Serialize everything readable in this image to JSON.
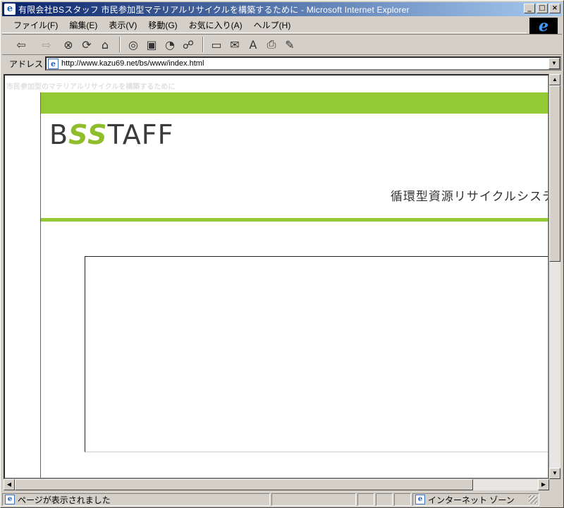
{
  "window": {
    "title": "有限会社BSスタッフ 市民参加型マテリアルリサイクルを構築するために - Microsoft Internet Explorer",
    "controls": {
      "minimize": "_",
      "maximize": "□",
      "close": "×"
    }
  },
  "menubar": {
    "items": [
      "ファイル(F)",
      "編集(E)",
      "表示(V)",
      "移動(G)",
      "お気に入り(A)",
      "ヘルプ(H)"
    ]
  },
  "toolbar": {
    "back": "⇦",
    "forward": "⇨",
    "stop": "⊗",
    "refresh": "⟳",
    "home": "⌂",
    "search": "◎",
    "favorites": "▣",
    "history": "◔",
    "channels": "☍",
    "fullscreen": "▭",
    "mail": "✉",
    "fonts": "A",
    "print": "⎙",
    "edit": "✎"
  },
  "address": {
    "label": "アドレス",
    "url": "http://www.kazu69.net/bs/www/index.html"
  },
  "page": {
    "caption": "市民参加型のマテリアルリサイクルを構築するために",
    "logo_b": "B",
    "logo_ss": "SS",
    "logo_rest": "TAFF",
    "subtitle": "循環型資源リサイクルシステ",
    "bottom_left_text": "",
    "bottom_right_text": ""
  },
  "colors": {
    "accent_green": "#93c935",
    "title_blue": "#0a246a"
  },
  "status": {
    "message": "ページが表示されました",
    "zone": "インターネット ゾーン"
  }
}
